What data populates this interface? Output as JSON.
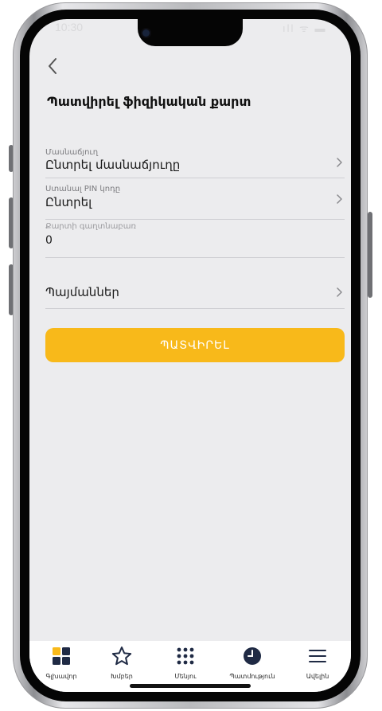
{
  "status_bar": {
    "time": "10:30",
    "right_icons": "ıll ᯤ ▬"
  },
  "header": {
    "title": "Պատվիրել ֆիզիկական քարտ"
  },
  "form": {
    "branch": {
      "label": "Մասնաճյուղ",
      "value": "Ընտրել մասնաճյուղը"
    },
    "pin": {
      "label": "Ստանալ PIN կոդը",
      "value": "Ընտրել"
    },
    "password": {
      "label": "Քարտի գաղտնաբառ",
      "value": "0"
    },
    "terms": {
      "label": "Պայմաններ"
    }
  },
  "confirm_button": {
    "label": "ՊԱՏՎԻՐԵԼ",
    "color": "#f8b91a"
  },
  "tabbar": {
    "items": [
      {
        "label": "Գլխավոր",
        "icon": "home-grid-icon"
      },
      {
        "label": "Խմբեր",
        "icon": "star-icon"
      },
      {
        "label": "Մենյու",
        "icon": "dots-grid-icon"
      },
      {
        "label": "Պատմություն",
        "icon": "clock-icon"
      },
      {
        "label": "Ավելին",
        "icon": "hamburger-menu-icon"
      }
    ]
  },
  "colors": {
    "accent": "#f8b91a",
    "screen_bg": "#ececee",
    "divider": "#cfcfd3"
  }
}
